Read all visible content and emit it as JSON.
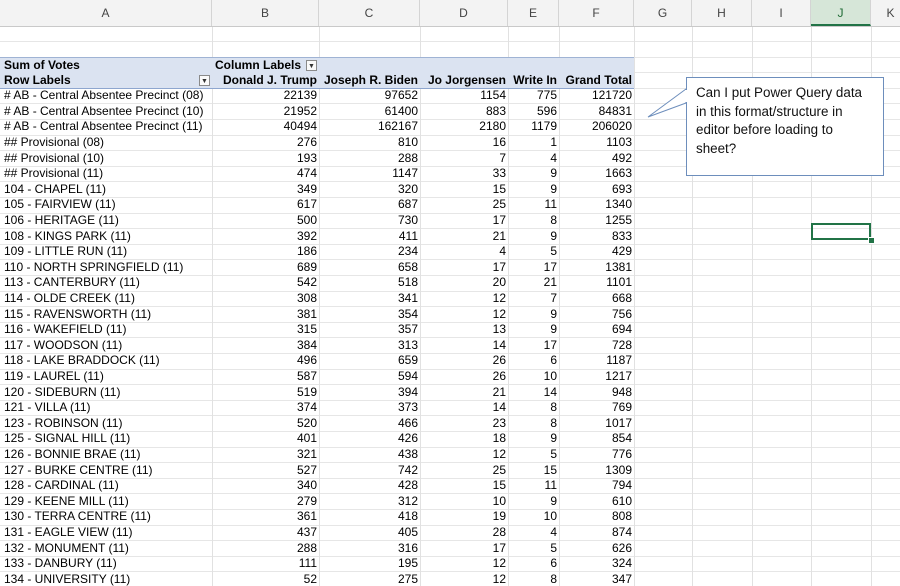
{
  "columns": [
    "A",
    "B",
    "C",
    "D",
    "E",
    "F",
    "G",
    "H",
    "I",
    "J",
    "K"
  ],
  "active_column": "J",
  "pivot": {
    "header_row1": {
      "label": "Sum of Votes",
      "col_labels": "Column Labels"
    },
    "header_row2": {
      "row_labels": "Row Labels",
      "c1": "Donald J. Trump",
      "c2": "Joseph R. Biden",
      "c3": "Jo Jorgensen",
      "c4": "Write In",
      "c5": "Grand Total"
    },
    "rows": [
      [
        "# AB - Central Absentee Precinct (08)",
        "22139",
        "97652",
        "1154",
        "775",
        "121720"
      ],
      [
        "# AB - Central Absentee Precinct (10)",
        "21952",
        "61400",
        "883",
        "596",
        "84831"
      ],
      [
        "# AB - Central Absentee Precinct (11)",
        "40494",
        "162167",
        "2180",
        "1179",
        "206020"
      ],
      [
        "## Provisional (08)",
        "276",
        "810",
        "16",
        "1",
        "1103"
      ],
      [
        "## Provisional (10)",
        "193",
        "288",
        "7",
        "4",
        "492"
      ],
      [
        "## Provisional (11)",
        "474",
        "1147",
        "33",
        "9",
        "1663"
      ],
      [
        "104 - CHAPEL (11)",
        "349",
        "320",
        "15",
        "9",
        "693"
      ],
      [
        "105 - FAIRVIEW (11)",
        "617",
        "687",
        "25",
        "11",
        "1340"
      ],
      [
        "106 - HERITAGE (11)",
        "500",
        "730",
        "17",
        "8",
        "1255"
      ],
      [
        "108 - KINGS PARK (11)",
        "392",
        "411",
        "21",
        "9",
        "833"
      ],
      [
        "109 - LITTLE RUN (11)",
        "186",
        "234",
        "4",
        "5",
        "429"
      ],
      [
        "110 - NORTH SPRINGFIELD (11)",
        "689",
        "658",
        "17",
        "17",
        "1381"
      ],
      [
        "113 - CANTERBURY (11)",
        "542",
        "518",
        "20",
        "21",
        "1101"
      ],
      [
        "114 - OLDE CREEK (11)",
        "308",
        "341",
        "12",
        "7",
        "668"
      ],
      [
        "115 - RAVENSWORTH (11)",
        "381",
        "354",
        "12",
        "9",
        "756"
      ],
      [
        "116 - WAKEFIELD (11)",
        "315",
        "357",
        "13",
        "9",
        "694"
      ],
      [
        "117 - WOODSON (11)",
        "384",
        "313",
        "14",
        "17",
        "728"
      ],
      [
        "118 - LAKE BRADDOCK (11)",
        "496",
        "659",
        "26",
        "6",
        "1187"
      ],
      [
        "119 - LAUREL (11)",
        "587",
        "594",
        "26",
        "10",
        "1217"
      ],
      [
        "120 - SIDEBURN (11)",
        "519",
        "394",
        "21",
        "14",
        "948"
      ],
      [
        "121 - VILLA (11)",
        "374",
        "373",
        "14",
        "8",
        "769"
      ],
      [
        "123 - ROBINSON (11)",
        "520",
        "466",
        "23",
        "8",
        "1017"
      ],
      [
        "125 - SIGNAL HILL (11)",
        "401",
        "426",
        "18",
        "9",
        "854"
      ],
      [
        "126 - BONNIE BRAE (11)",
        "321",
        "438",
        "12",
        "5",
        "776"
      ],
      [
        "127 - BURKE CENTRE (11)",
        "527",
        "742",
        "25",
        "15",
        "1309"
      ],
      [
        "128 - CARDINAL (11)",
        "340",
        "428",
        "15",
        "11",
        "794"
      ],
      [
        "129 - KEENE MILL (11)",
        "279",
        "312",
        "10",
        "9",
        "610"
      ],
      [
        "130 - TERRA CENTRE (11)",
        "361",
        "418",
        "19",
        "10",
        "808"
      ],
      [
        "131 - EAGLE VIEW (11)",
        "437",
        "405",
        "28",
        "4",
        "874"
      ],
      [
        "132 - MONUMENT (11)",
        "288",
        "316",
        "17",
        "5",
        "626"
      ],
      [
        "133 - DANBURY (11)",
        "111",
        "195",
        "12",
        "6",
        "324"
      ],
      [
        "134 - UNIVERSITY (11)",
        "52",
        "275",
        "12",
        "8",
        "347"
      ]
    ]
  },
  "callout": {
    "text": "Can I put Power Query data in this format/structure in editor before loading to sheet?"
  },
  "icons": {
    "filter": "dropdown-arrow-icon"
  },
  "colors": {
    "pivot_header": "#dbe3f1",
    "selection": "#217346",
    "callout_border": "#6d8ebc"
  }
}
